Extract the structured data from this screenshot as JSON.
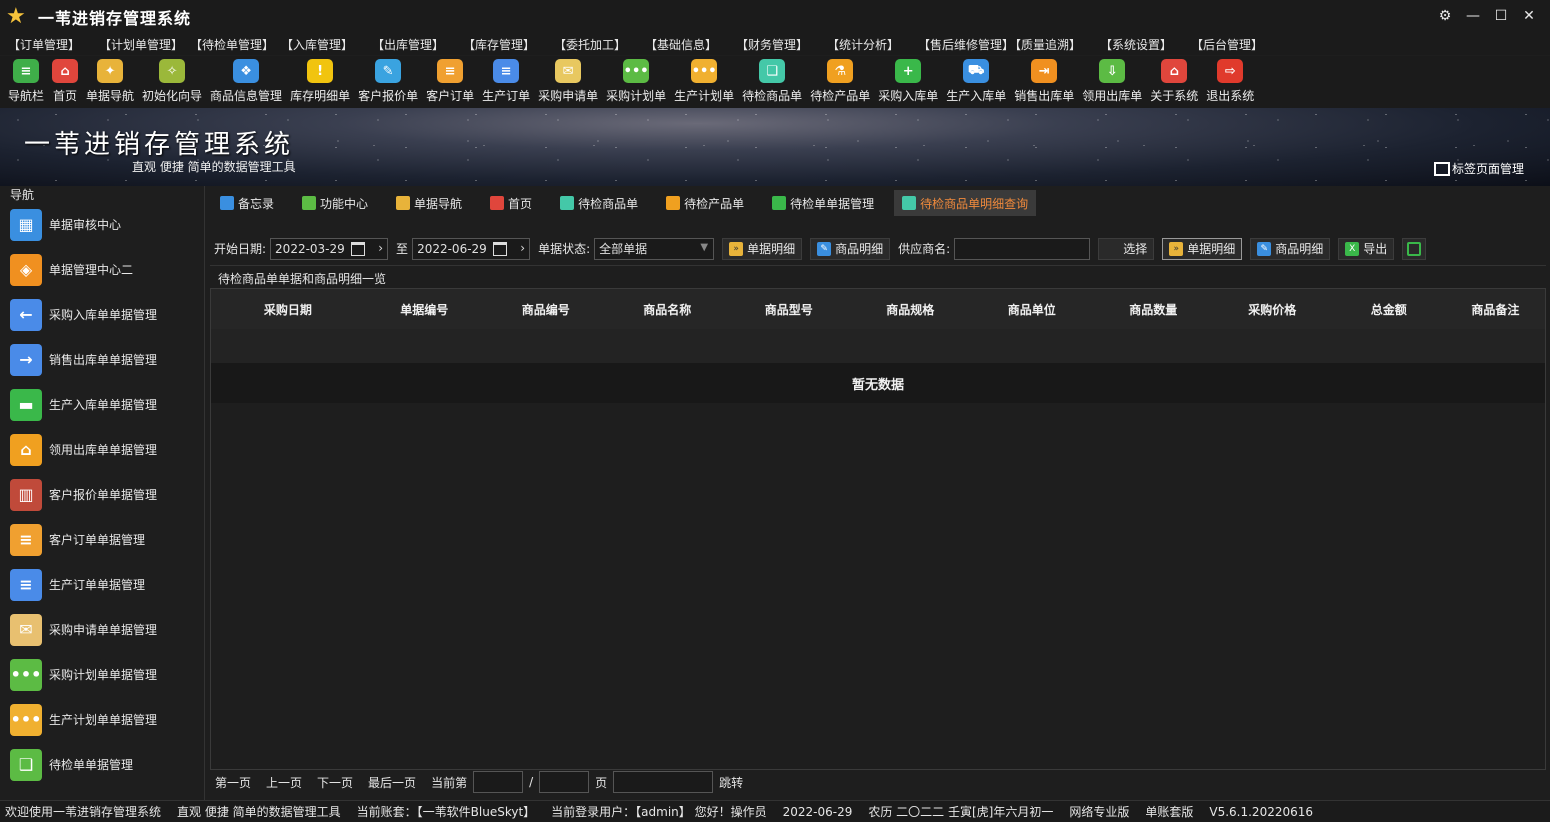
{
  "window": {
    "title": "一苇进销存管理系统",
    "controls": [
      "⚙",
      "—",
      "☐",
      "✕"
    ]
  },
  "menu": [
    "【订单管理】",
    "【计划单管理】",
    "【待检单管理】",
    "【入库管理】",
    "【出库管理】",
    "【库存管理】",
    "【委托加工】",
    "【基础信息】",
    "【财务管理】",
    "【统计分析】",
    "【售后维修管理】",
    "【质量追溯】",
    "【系统设置】",
    "【后台管理】"
  ],
  "toolbar": [
    {
      "label": "导航栏",
      "icon": "menu-lines-icon",
      "color": "#3fae49",
      "glyph": "≡"
    },
    {
      "label": "首页",
      "icon": "home-icon",
      "color": "#e0463c",
      "glyph": "⌂"
    },
    {
      "label": "单据导航",
      "icon": "guide-icon",
      "color": "#e8b33a",
      "glyph": "✦"
    },
    {
      "label": "初始化向导",
      "icon": "wand-icon",
      "color": "#9bb83a",
      "glyph": "✧"
    },
    {
      "label": "商品信息管理",
      "icon": "cubes-icon",
      "color": "#3a8fe0",
      "glyph": "❖"
    },
    {
      "label": "库存明细单",
      "icon": "warning-icon",
      "color": "#f1c40f",
      "glyph": "!"
    },
    {
      "label": "客户报价单",
      "icon": "tag-icon",
      "color": "#3aa3e0",
      "glyph": "✎"
    },
    {
      "label": "客户订单",
      "icon": "order-icon",
      "color": "#f0a030",
      "glyph": "≡"
    },
    {
      "label": "生产订单",
      "icon": "doc-icon",
      "color": "#4a8be8",
      "glyph": "≡"
    },
    {
      "label": "采购申请单",
      "icon": "envelope-icon",
      "color": "#e8c860",
      "glyph": "✉"
    },
    {
      "label": "采购计划单",
      "icon": "chat-icon",
      "color": "#5cbb44",
      "glyph": "•••"
    },
    {
      "label": "生产计划单",
      "icon": "chat-icon",
      "color": "#f0b030",
      "glyph": "•••"
    },
    {
      "label": "待检商品单",
      "icon": "inspect-icon",
      "color": "#44c8a8",
      "glyph": "❑"
    },
    {
      "label": "待检产品单",
      "icon": "flask-icon",
      "color": "#f0a020",
      "glyph": "⚗"
    },
    {
      "label": "采购入库单",
      "icon": "plus-circle-icon",
      "color": "#3ab84a",
      "glyph": "+"
    },
    {
      "label": "生产入库单",
      "icon": "truck-icon",
      "color": "#3a8fe0",
      "glyph": "⛟"
    },
    {
      "label": "销售出库单",
      "icon": "out-icon",
      "color": "#f09020",
      "glyph": "⇥"
    },
    {
      "label": "领用出库单",
      "icon": "download-icon",
      "color": "#5cbb44",
      "glyph": "⇩"
    },
    {
      "label": "关于系统",
      "icon": "house-info-icon",
      "color": "#e0463c",
      "glyph": "⌂"
    },
    {
      "label": "退出系统",
      "icon": "exit-icon",
      "color": "#e03a2c",
      "glyph": "⇨"
    }
  ],
  "banner": {
    "title": "一苇进销存管理系统",
    "subtitle": "直观 便捷 简单的数据管理工具",
    "tab_manage": "标签页面管理"
  },
  "sidebar": {
    "header": "导航",
    "items": [
      {
        "label": "单据审核中心",
        "icon": "grid-icon",
        "color": "#3a8fe0",
        "glyph": "▦"
      },
      {
        "label": "单据管理中心二",
        "icon": "grid-diamond-icon",
        "color": "#f09020",
        "glyph": "◈"
      },
      {
        "label": "采购入库单单据管理",
        "icon": "arrow-left-icon",
        "color": "#4a8be8",
        "glyph": "←"
      },
      {
        "label": "销售出库单单据管理",
        "icon": "arrow-right-icon",
        "color": "#4a8be8",
        "glyph": "→"
      },
      {
        "label": "生产入库单单据管理",
        "icon": "folder-icon",
        "color": "#3ab84a",
        "glyph": "▬"
      },
      {
        "label": "领用出库单单据管理",
        "icon": "home-doc-icon",
        "color": "#f0a020",
        "glyph": "⌂"
      },
      {
        "label": "客户报价单单据管理",
        "icon": "books-icon",
        "color": "#c04a3a",
        "glyph": "▥"
      },
      {
        "label": "客户订单单据管理",
        "icon": "order-icon",
        "color": "#f0a030",
        "glyph": "≡"
      },
      {
        "label": "生产订单单据管理",
        "icon": "doc-icon",
        "color": "#4a8be8",
        "glyph": "≡"
      },
      {
        "label": "采购申请单单据管理",
        "icon": "envelope-icon",
        "color": "#e8c070",
        "glyph": "✉"
      },
      {
        "label": "采购计划单单据管理",
        "icon": "chat-icon",
        "color": "#5cbb44",
        "glyph": "•••"
      },
      {
        "label": "生产计划单单据管理",
        "icon": "chat-icon",
        "color": "#f0b030",
        "glyph": "•••"
      },
      {
        "label": "待检单单据管理",
        "icon": "inspect-doc-icon",
        "color": "#5cbb44",
        "glyph": "❑"
      }
    ]
  },
  "tabs": [
    {
      "label": "备忘录",
      "icon": "memo-icon",
      "color": "#3a8fe0",
      "active": false
    },
    {
      "label": "功能中心",
      "icon": "function-icon",
      "color": "#5cbb44",
      "active": false
    },
    {
      "label": "单据导航",
      "icon": "guide-icon",
      "color": "#e8b33a",
      "active": false
    },
    {
      "label": "首页",
      "icon": "home-icon",
      "color": "#e0463c",
      "active": false
    },
    {
      "label": "待检商品单",
      "icon": "inspect-icon",
      "color": "#44c8a8",
      "active": false
    },
    {
      "label": "待检产品单",
      "icon": "flask-icon",
      "color": "#f0a020",
      "active": false
    },
    {
      "label": "待检单单据管理",
      "icon": "inspect-doc-icon",
      "color": "#3ab84a",
      "active": false
    },
    {
      "label": "待检商品单明细查询",
      "icon": "inspect-icon",
      "color": "#44c8a8",
      "active": true
    }
  ],
  "filter": {
    "start_label": "开始日期:",
    "start_date": "2022-03-29",
    "to_label": "至",
    "end_date": "2022-06-29",
    "status_label": "单据状态:",
    "status_value": "全部单据",
    "btn_doc_detail": "单据明细",
    "btn_goods_detail": "商品明细",
    "supplier_label": "供应商名:",
    "supplier_value": "",
    "btn_select": "选择",
    "btn_doc_detail2": "单据明细",
    "btn_goods_detail2": "商品明细",
    "btn_export": "导出"
  },
  "grid": {
    "caption": "待检商品单单据和商品明细一览",
    "columns": [
      "采购日期",
      "单据编号",
      "商品编号",
      "商品名称",
      "商品型号",
      "商品规格",
      "商品单位",
      "商品数量",
      "采购价格",
      "总金额",
      "商品备注"
    ],
    "empty_text": "暂无数据"
  },
  "pager": {
    "first": "第一页",
    "prev": "上一页",
    "next": "下一页",
    "last": "最后一页",
    "current_label": "当前第",
    "slash": "/",
    "page_label": "页",
    "jump": "跳转"
  },
  "status": [
    "欢迎使用一苇进销存管理系统",
    "直观 便捷 简单的数据管理工具",
    "当前账套：【一苇软件BlueSkyt】",
    "当前登录用户：【admin】 您好！操作员",
    "2022-06-29",
    "农历 二〇二二 壬寅[虎]年六月初一",
    "网络专业版",
    "单账套版",
    "V5.6.1.20220616"
  ]
}
